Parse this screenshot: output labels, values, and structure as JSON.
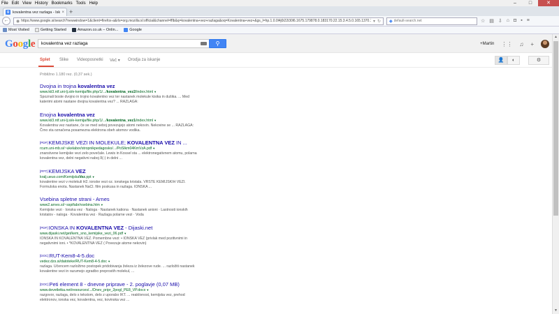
{
  "menubar": [
    "File",
    "Edit",
    "View",
    "History",
    "Bookmarks",
    "Tools",
    "Help"
  ],
  "tab": {
    "title": "kovalentna vez razlaga - Isk..."
  },
  "nav": {
    "url": "https://www.google.si/search?newwindow=1&client=firefox-a&rls=org.mozilla:sl:official&channel=fflb&q=kovalentna+vez+razlaga&oq=Kovalentna+vez+&gs_l=hp.1.0.0l4j0i22i30l6.1675.179878.0.183170.22.15.3.4.5.0.165.1370.12j2.14.0....0...1c.1.51.hp..2.20.1441.0.Kkkl",
    "search_placeholder": "default-search.net"
  },
  "bookmarks": [
    "Most Visited",
    "Getting Started",
    "Amazon.co.uk – Onlin...",
    "Google"
  ],
  "google": {
    "query": "kovalentna vez razlaga",
    "user": "+Martin"
  },
  "search_tabs": [
    "Splet",
    "Slike",
    "Videoposnetki",
    "Več",
    "Orodja za iskanje"
  ],
  "stats": "Približno 1.180 rez.  (0,37 sek.)",
  "results": [
    {
      "tag": "",
      "title": [
        "Dvojna in trojna ",
        "kovalentna vez",
        ""
      ],
      "url": [
        "www.kii3.ntf.uni-lj.si/e-kemija/file.php/1/.../",
        "kovalentna_vez2",
        "/index.html"
      ],
      "snippet": "Spoznali boste dvojno in trojno kovalentno vez ter nastanek molekule kisika in dušika. ... Med katerimi atomi nastane dvojna kovalentna vez? ... RAZLAGA:"
    },
    {
      "tag": "",
      "title": [
        "Enojna ",
        "kovalentna vez",
        ""
      ],
      "url": [
        "www.kii3.ntf.uni-lj.si/e-kemija/file.php/1/.../",
        "kovalentna_vez1",
        "/index.html"
      ],
      "snippet": "Kovalentna vez nastane, če se med seboj povezujejo atomi nekovin. Nekovine se ... RAZLAGA: Črno sta označena posamezna elektrona obeh atomov vodika."
    },
    {
      "tag": "[PDF]",
      "title": [
        "KEMIJSKE VEZI IN MOLEKULE; ",
        "KOVALENTNA VEZ",
        " IN ..."
      ],
      "url": [
        "rcum.uni-mb.si/~ukelabor/stropnikpedagosko/.../PoSlkm04KmVzA.pdf",
        "",
        ""
      ],
      "snippet": "znanstvene kemijske vezi zelo povečale. Lewis in Kossel sta ... elektronegativnem atomu, polarna kovalentna vez, delni negativni naboj δ(-) in delni ..."
    },
    {
      "tag": "[PPT]",
      "title": [
        "KEMIJSKA ",
        "VEZ",
        ""
      ],
      "url": [
        "kralj.ueuo.com/Kemijska",
        "Vez",
        ".ppt"
      ],
      "snippet": "kovalentne vezi v molekuli H2. ionske vezi oz. ionskega kristala. VRSTE KEMIJSKIH VEZI. Formulska enota. Nastanek NaCl. film poskusa in razlaga. IONSKA ..."
    },
    {
      "tag": "",
      "title": [
        "Vsebina spletne strani - Arnes",
        "",
        ""
      ],
      "url": [
        "www2.arnes.si/~sspifabr/vsebina.htm",
        "",
        ""
      ],
      "snippet": "Kemijske vezi · Ionska vez · Naloga · Nastanek kationa · Nastanek anioni · Lastnosti ionskih kristalov - naloga · Kovalentna vez · Razlaga polarne vezi · Voda"
    },
    {
      "tag": "[PDF]",
      "title": [
        "IONSKA IN ",
        "KOVALENTNA VEZ",
        " - Dijaski.net"
      ],
      "url": [
        "www.dijaski.net/get/kem_sno_kemijske_vezi_06.pdf",
        "",
        ""
      ],
      "snippet": "IONSKA IN KOVALENTNA VEZ. Pomembne vezi: • IONSKA VEZ (privlak med pozitivnimi in negativnimi ioni. • *KOVALENTNA VEZ ( Povezuje atome nekovin)"
    },
    {
      "tag": "[DOC]",
      "title": [
        "RUT-Kem8-4-5.doc",
        "",
        ""
      ],
      "url": [
        "vedez.dzs.si/datoteke/RUT-Kem8-4-5.doc",
        "",
        ""
      ],
      "snippet": "razlaga. Učencem razložimo postopek pridobivanja železa iz železove rude. ... razložiti nastanek kovalentne vezi in razumejo zgradbo preprostih molekul, ..."
    },
    {
      "tag": "[DOC]",
      "title": [
        "Peti element 8 - dnevne priprave - 2. poglavje (0,07 MB)",
        "",
        ""
      ],
      "url": [
        "www.devetletka.net/resources/.../Dnev_pripr_2pogl_PE8_VP.docx",
        "",
        ""
      ],
      "snippet": "razgovor, razlaga, delo s tekstom, delo z uporabo IKT. ... reaktivnost, kemijska vez, prehod elektronov, ionska vez, kovalentna, vez, kovinska vez ..."
    }
  ],
  "colors": {
    "link": "#1a0dab",
    "url": "#006621",
    "snippet": "#545454",
    "active_tab": "#dd4b39",
    "search_button": "#4285f4"
  }
}
